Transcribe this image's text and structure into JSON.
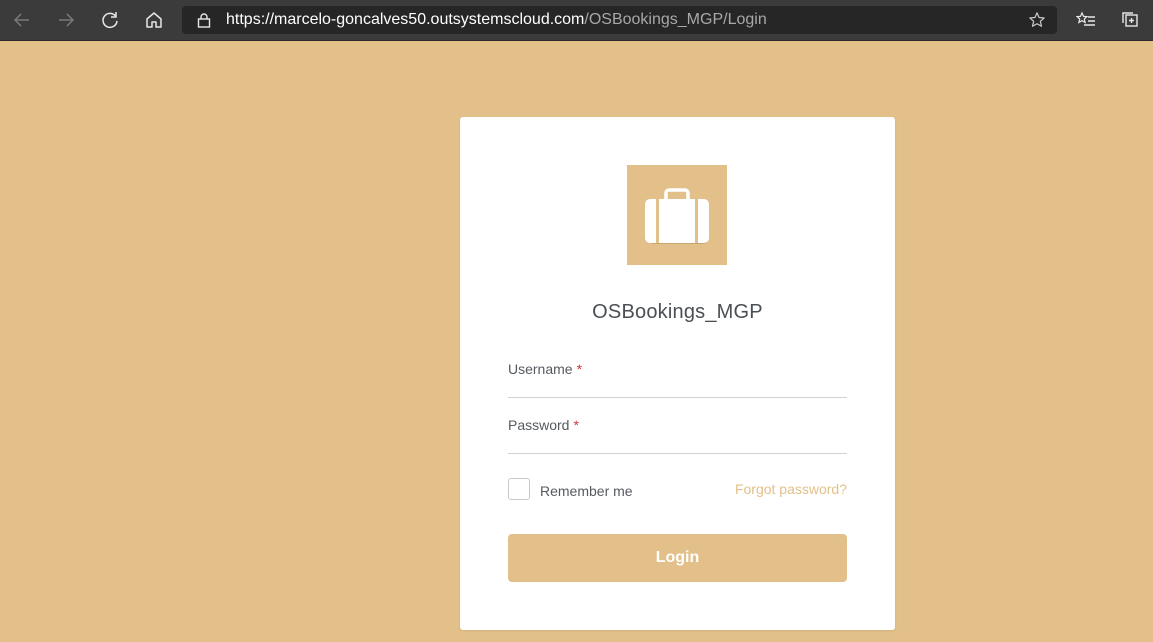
{
  "browser": {
    "url_host": "https://marcelo-goncalves50.outsystemscloud.com",
    "url_path": "/OSBookings_MGP/Login",
    "icons": [
      "back-arrow-icon",
      "forward-arrow-icon",
      "refresh-icon",
      "home-icon",
      "lock-icon",
      "favorite-star-icon",
      "favorites-list-icon",
      "collections-icon"
    ]
  },
  "login": {
    "logo_icon": "briefcase-icon",
    "app_name": "OSBookings_MGP",
    "username_label": "Username",
    "password_label": "Password",
    "required_mark": "*",
    "remember_label": "Remember me",
    "remember_checked": false,
    "forgot_label": "Forgot password?",
    "login_label": "Login"
  },
  "colors": {
    "background": "#e3c08a",
    "accent": "#e3c08a",
    "required": "#d0333f",
    "card": "#ffffff"
  }
}
